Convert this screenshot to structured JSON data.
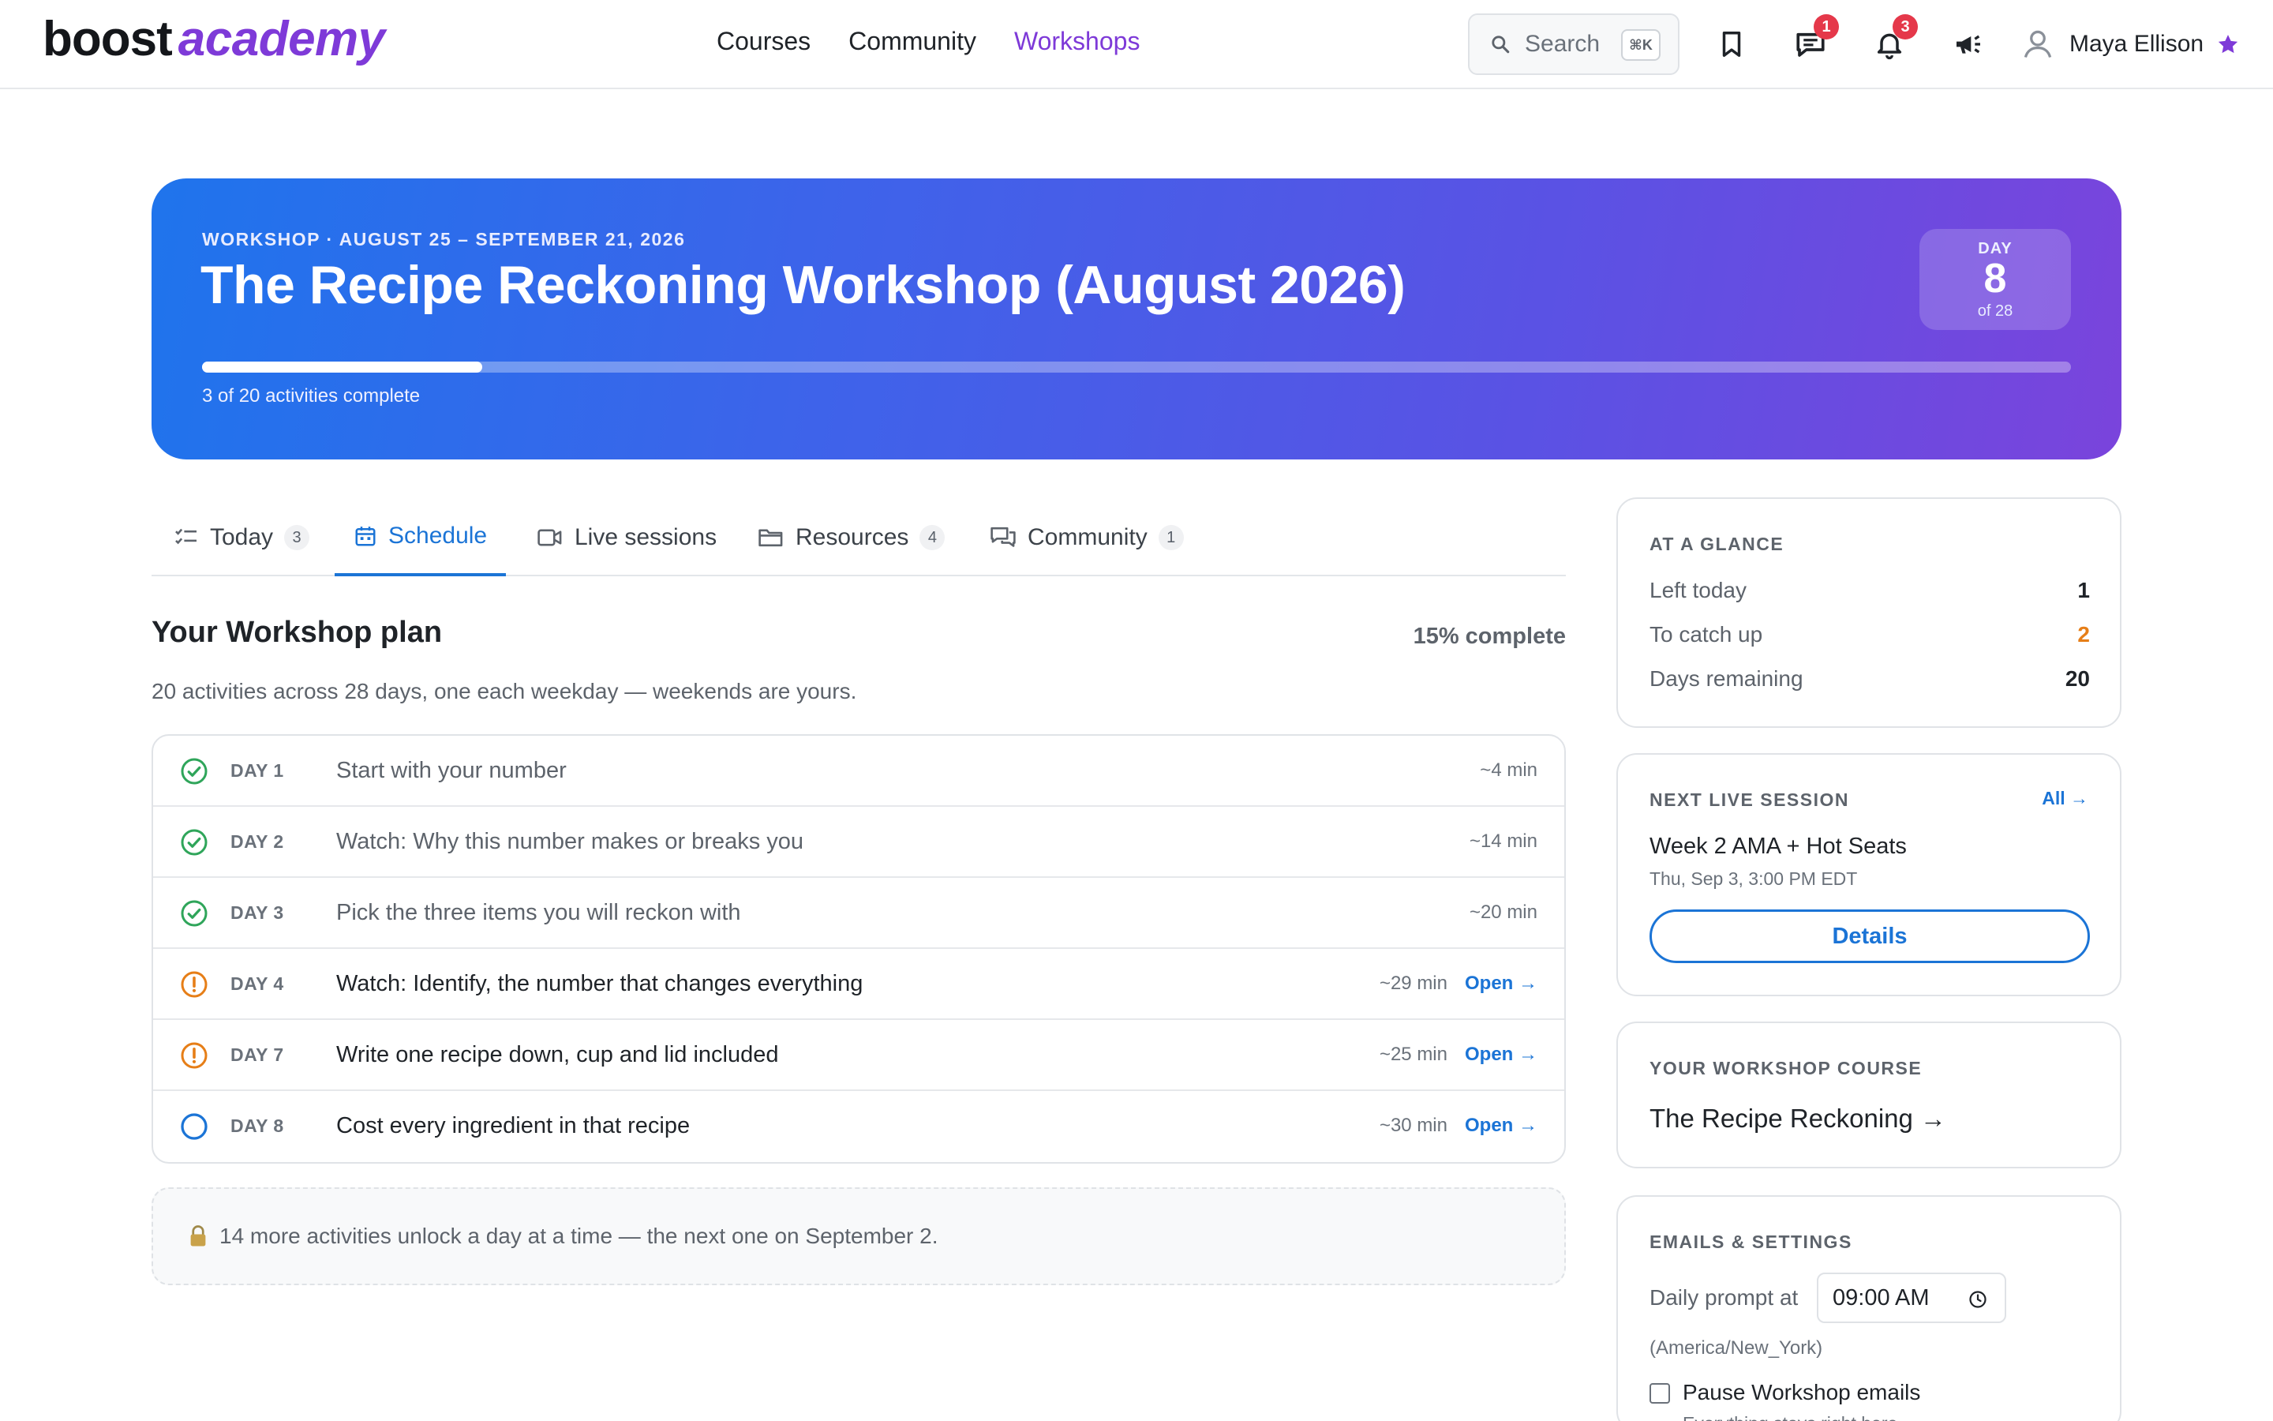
{
  "brand": {
    "name_a": "boost",
    "name_b": "academy",
    "accent": "#7e3ad8"
  },
  "nav": {
    "links": [
      {
        "label": "Courses",
        "active": false
      },
      {
        "label": "Community",
        "active": false
      },
      {
        "label": "Workshops",
        "active": true
      }
    ],
    "search": {
      "label": "Search",
      "shortcut": "⌘K"
    },
    "messages_badge": "1",
    "notifications_badge": "3",
    "user_name": "Maya Ellison"
  },
  "hero": {
    "eyebrow": "WORKSHOP · AUGUST 25 – SEPTEMBER 21, 2026",
    "title": "The Recipe Reckoning Workshop (August 2026)",
    "progress_fraction": 0.15,
    "progress_text": "3 of 20 activities complete",
    "day_label": "DAY",
    "day_number": "8",
    "day_of": "of 28"
  },
  "tabs": [
    {
      "label": "Today",
      "count": "3",
      "icon": "checklist-icon",
      "active": false
    },
    {
      "label": "Schedule",
      "count": "",
      "icon": "calendar-icon",
      "active": true
    },
    {
      "label": "Live sessions",
      "count": "",
      "icon": "video-icon",
      "active": false
    },
    {
      "label": "Resources",
      "count": "4",
      "icon": "folder-icon",
      "active": false
    },
    {
      "label": "Community",
      "count": "1",
      "icon": "chat-icon",
      "active": false
    }
  ],
  "plan": {
    "title": "Your Workshop plan",
    "percent": "15% complete",
    "subtitle": "20 activities across 28 days, one each weekday — weekends are yours.",
    "rows": [
      {
        "day": "DAY 1",
        "title": "Start with your number",
        "duration": "~4 min",
        "status": "done",
        "open": ""
      },
      {
        "day": "DAY 2",
        "title": "Watch: Why this number makes or breaks you",
        "duration": "~14 min",
        "status": "done",
        "open": ""
      },
      {
        "day": "DAY 3",
        "title": "Pick the three items you will reckon with",
        "duration": "~20 min",
        "status": "done",
        "open": ""
      },
      {
        "day": "DAY 4",
        "title": "Watch: Identify, the number that changes everything",
        "duration": "~29 min",
        "status": "overdue",
        "open": "Open →"
      },
      {
        "day": "DAY 7",
        "title": "Write one recipe down, cup and lid included",
        "duration": "~25 min",
        "status": "overdue",
        "open": "Open →"
      },
      {
        "day": "DAY 8",
        "title": "Cost every ingredient in that recipe",
        "duration": "~30 min",
        "status": "today",
        "open": "Open →"
      }
    ],
    "unlock_text": "14 more activities unlock a day at a time — the next one on September 2."
  },
  "sidebar": {
    "glance": {
      "heading": "AT A GLANCE",
      "rows": [
        {
          "label": "Left today",
          "value": "1",
          "warn": false
        },
        {
          "label": "To catch up",
          "value": "2",
          "warn": true
        },
        {
          "label": "Days remaining",
          "value": "20",
          "warn": false
        }
      ]
    },
    "session": {
      "heading": "NEXT LIVE SESSION",
      "all_link": "All →",
      "title": "Week 2 AMA + Hot Seats",
      "time": "Thu, Sep 3, 3:00 PM EDT",
      "button": "Details"
    },
    "course": {
      "heading": "YOUR WORKSHOP COURSE",
      "link": "The Recipe Reckoning →"
    },
    "settings": {
      "heading": "EMAILS & SETTINGS",
      "prompt_label": "Daily prompt at",
      "time_value": "09:00 AM",
      "timezone": "(America/New_York)",
      "pause_label": "Pause Workshop emails",
      "pause_help": "Everything stays right here."
    }
  },
  "colors": {
    "primary": "#1b74d6",
    "done": "#2fa55a",
    "warn": "#e67e17",
    "badge": "#e5384a"
  }
}
